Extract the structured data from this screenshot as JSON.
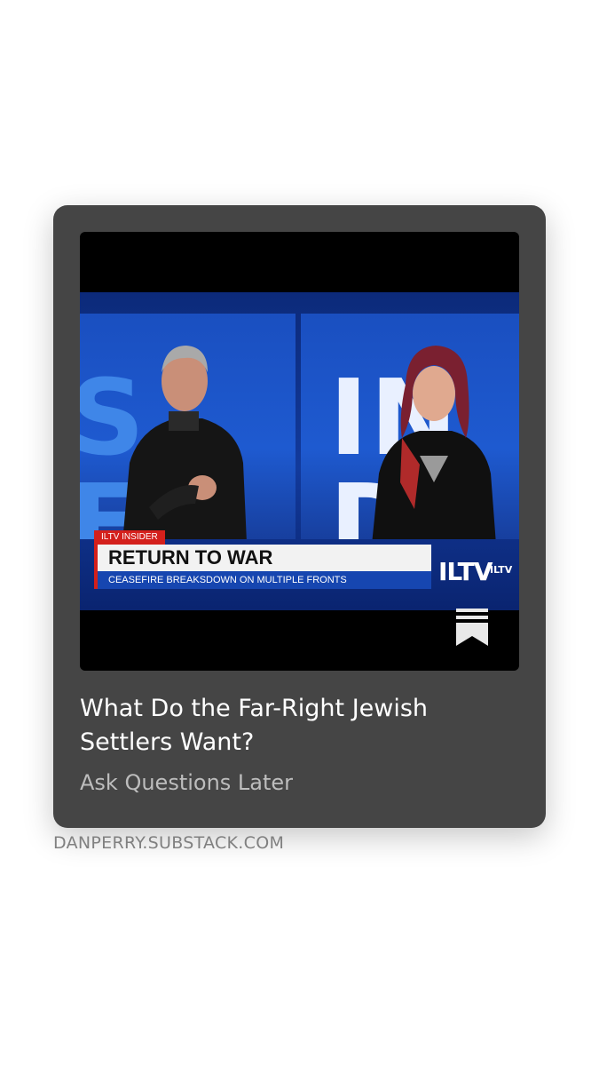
{
  "card": {
    "title": "What Do the Far-Right Jewish Settlers Want?",
    "publication": "Ask Questions Later",
    "thumbnail": {
      "tag": "ILTV INSIDER",
      "headline": "RETURN TO WAR",
      "ticker": "CEASEFIRE BREAKSDOWN ON MULTIPLE FRONTS",
      "logo": "ILTV",
      "logo_small": "ILTV",
      "background_left": "S  FR",
      "background_right": "IN  D"
    },
    "icon": "bookmark-icon"
  },
  "domain": "DANPERRY.SUBSTACK.COM",
  "colors": {
    "card_bg": "#454545",
    "title": "#ffffff",
    "subtitle": "#bdbdbd",
    "domain": "#808080",
    "accent_red": "#d4201c",
    "broadcast_blue": "#1646b0"
  }
}
